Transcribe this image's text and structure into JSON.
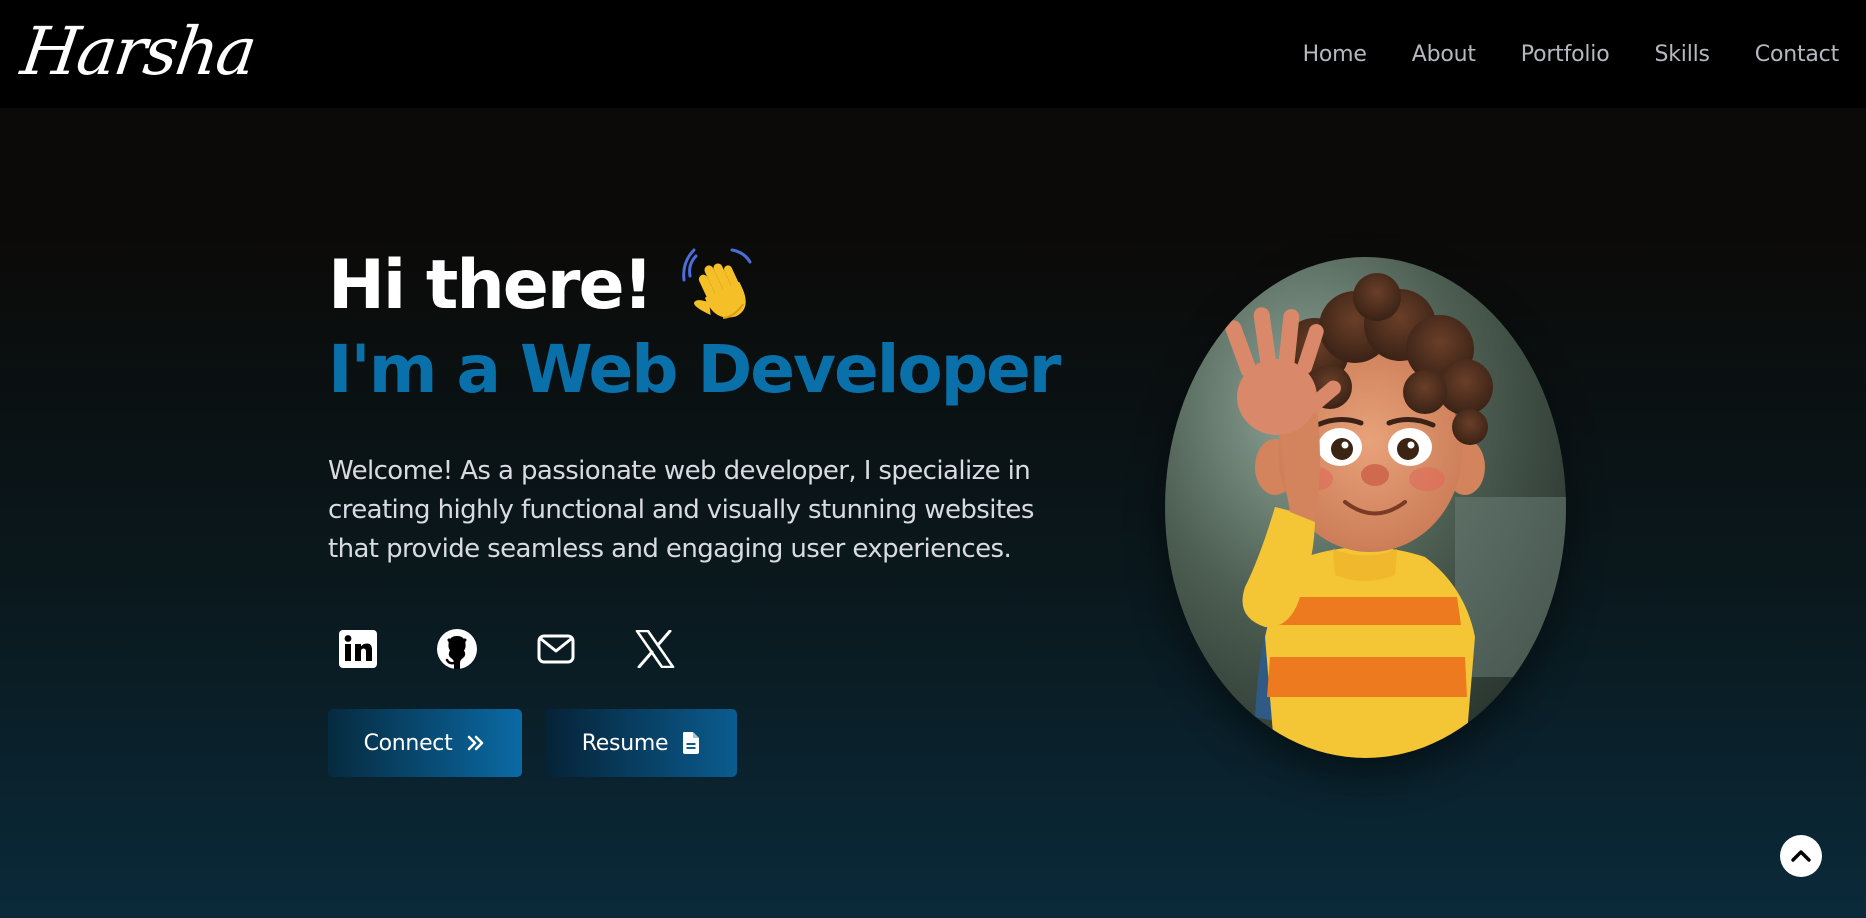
{
  "brand": {
    "name": "Harsha"
  },
  "nav": {
    "items": [
      {
        "label": "Home"
      },
      {
        "label": "About"
      },
      {
        "label": "Portfolio"
      },
      {
        "label": "Skills"
      },
      {
        "label": "Contact"
      }
    ]
  },
  "hero": {
    "greeting": "Hi there!",
    "wave_emoji": "waving-hand-icon",
    "role": "I'm a Web Developer",
    "intro": "Welcome! As a passionate web developer, I specialize in creating highly functional and visually stunning websites that provide seamless and engaging user experiences.",
    "socials": [
      {
        "icon": "linkedin-icon"
      },
      {
        "icon": "github-icon"
      },
      {
        "icon": "mail-icon"
      },
      {
        "icon": "x-twitter-icon"
      }
    ],
    "buttons": {
      "connect_label": "Connect",
      "resume_label": "Resume"
    }
  },
  "colors": {
    "accent": "#0a70aa",
    "nav_text": "#b4b8bf",
    "navbar_bg": "#000000"
  }
}
